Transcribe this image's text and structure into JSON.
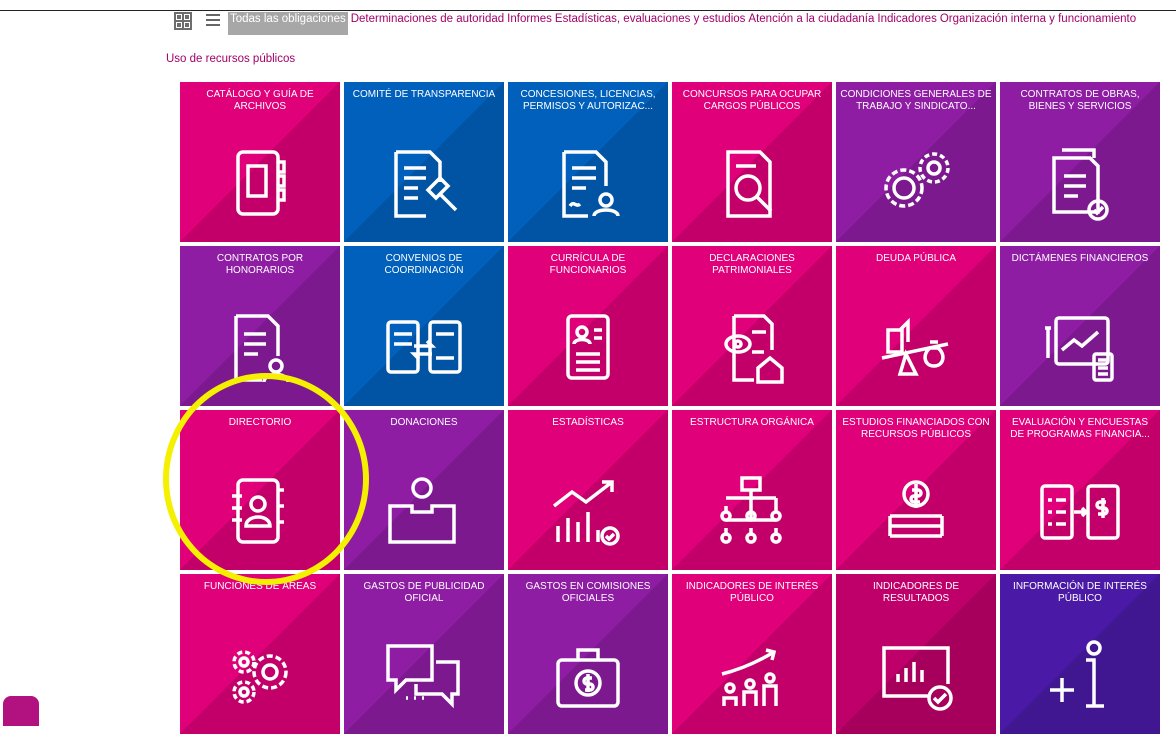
{
  "filters": {
    "active": "Todas las obligaciones",
    "items": [
      "Determinaciones de autoridad",
      "Informes",
      "Estadísticas, evaluaciones y estudios",
      "Atención a la ciudadanía",
      "Indicadores",
      "Organización interna y funcionamiento"
    ],
    "second_row": "Uso de recursos públicos"
  },
  "tiles": [
    {
      "label": "CATÁLOGO Y GUÍA DE ARCHIVOS",
      "color": "#e0007a",
      "icon": "binder-icon"
    },
    {
      "label": "COMITÉ DE TRANSPARENCIA",
      "color": "#0060bb",
      "icon": "document-gavel-icon"
    },
    {
      "label": "CONCESIONES, LICENCIAS, PERMISOS Y AUTORIZAC...",
      "color": "#0060bb",
      "icon": "document-user-icon"
    },
    {
      "label": "CONCURSOS PARA OCUPAR CARGOS PÚBLICOS",
      "color": "#e0007a",
      "icon": "document-search-icon"
    },
    {
      "label": "CONDICIONES GENERALES DE TRABAJO Y SINDICATO...",
      "color": "#8e1da4",
      "icon": "gears-user-icon"
    },
    {
      "label": "CONTRATOS DE OBRAS, BIENES Y SERVICIOS",
      "color": "#8e1da4",
      "icon": "documents-check-icon"
    },
    {
      "label": "CONTRATOS POR HONORARIOS",
      "color": "#8e1da4",
      "icon": "document-person-icon"
    },
    {
      "label": "CONVENIOS DE COORDINACIÓN",
      "color": "#0060bb",
      "icon": "documents-exchange-icon"
    },
    {
      "label": "CURRÍCULA DE FUNCIONARIOS",
      "color": "#e0007a",
      "icon": "resume-icon"
    },
    {
      "label": "DECLARACIONES PATRIMONIALES",
      "color": "#e0007a",
      "icon": "document-eye-house-icon"
    },
    {
      "label": "DEUDA PÚBLICA",
      "color": "#e0007a",
      "icon": "balance-money-icon"
    },
    {
      "label": "DICTÁMENES FINANCIEROS",
      "color": "#8e1da4",
      "icon": "chart-calculator-icon"
    },
    {
      "label": "DIRECTORIO",
      "color": "#e0007a",
      "icon": "contacts-book-icon"
    },
    {
      "label": "DONACIONES",
      "color": "#8e1da4",
      "icon": "donation-box-icon"
    },
    {
      "label": "ESTADÍSTICAS",
      "color": "#e0007a",
      "icon": "bar-chart-trend-icon"
    },
    {
      "label": "ESTRUCTURA ORGÁNICA",
      "color": "#e0007a",
      "icon": "org-chart-icon"
    },
    {
      "label": "ESTUDIOS FINANCIADOS CON RECURSOS PÚBLICOS",
      "color": "#e0007a",
      "icon": "coins-stack-icon"
    },
    {
      "label": "EVALUACIÓN Y ENCUESTAS DE PROGRAMAS FINANCIA...",
      "color": "#e0007a",
      "icon": "checklist-money-icon"
    },
    {
      "label": "FUNCIONES DE ÁREAS",
      "color": "#e0007a",
      "icon": "gears-icon"
    },
    {
      "label": "GASTOS DE PUBLICIDAD OFICIAL",
      "color": "#8e1da4",
      "icon": "chat-bubbles-icon"
    },
    {
      "label": "GASTOS EN COMISIONES OFICIALES",
      "color": "#8e1da4",
      "icon": "briefcase-money-icon"
    },
    {
      "label": "INDICADORES DE INTERÉS PÚBLICO",
      "color": "#e0007a",
      "icon": "people-growth-icon"
    },
    {
      "label": "INDICADORES DE RESULTADOS",
      "color": "#c0006a",
      "icon": "monitor-chart-check-icon"
    },
    {
      "label": "INFORMACIÓN DE INTERÉS PÚBLICO",
      "color": "#4a1aa6",
      "icon": "plus-info-icon"
    }
  ]
}
